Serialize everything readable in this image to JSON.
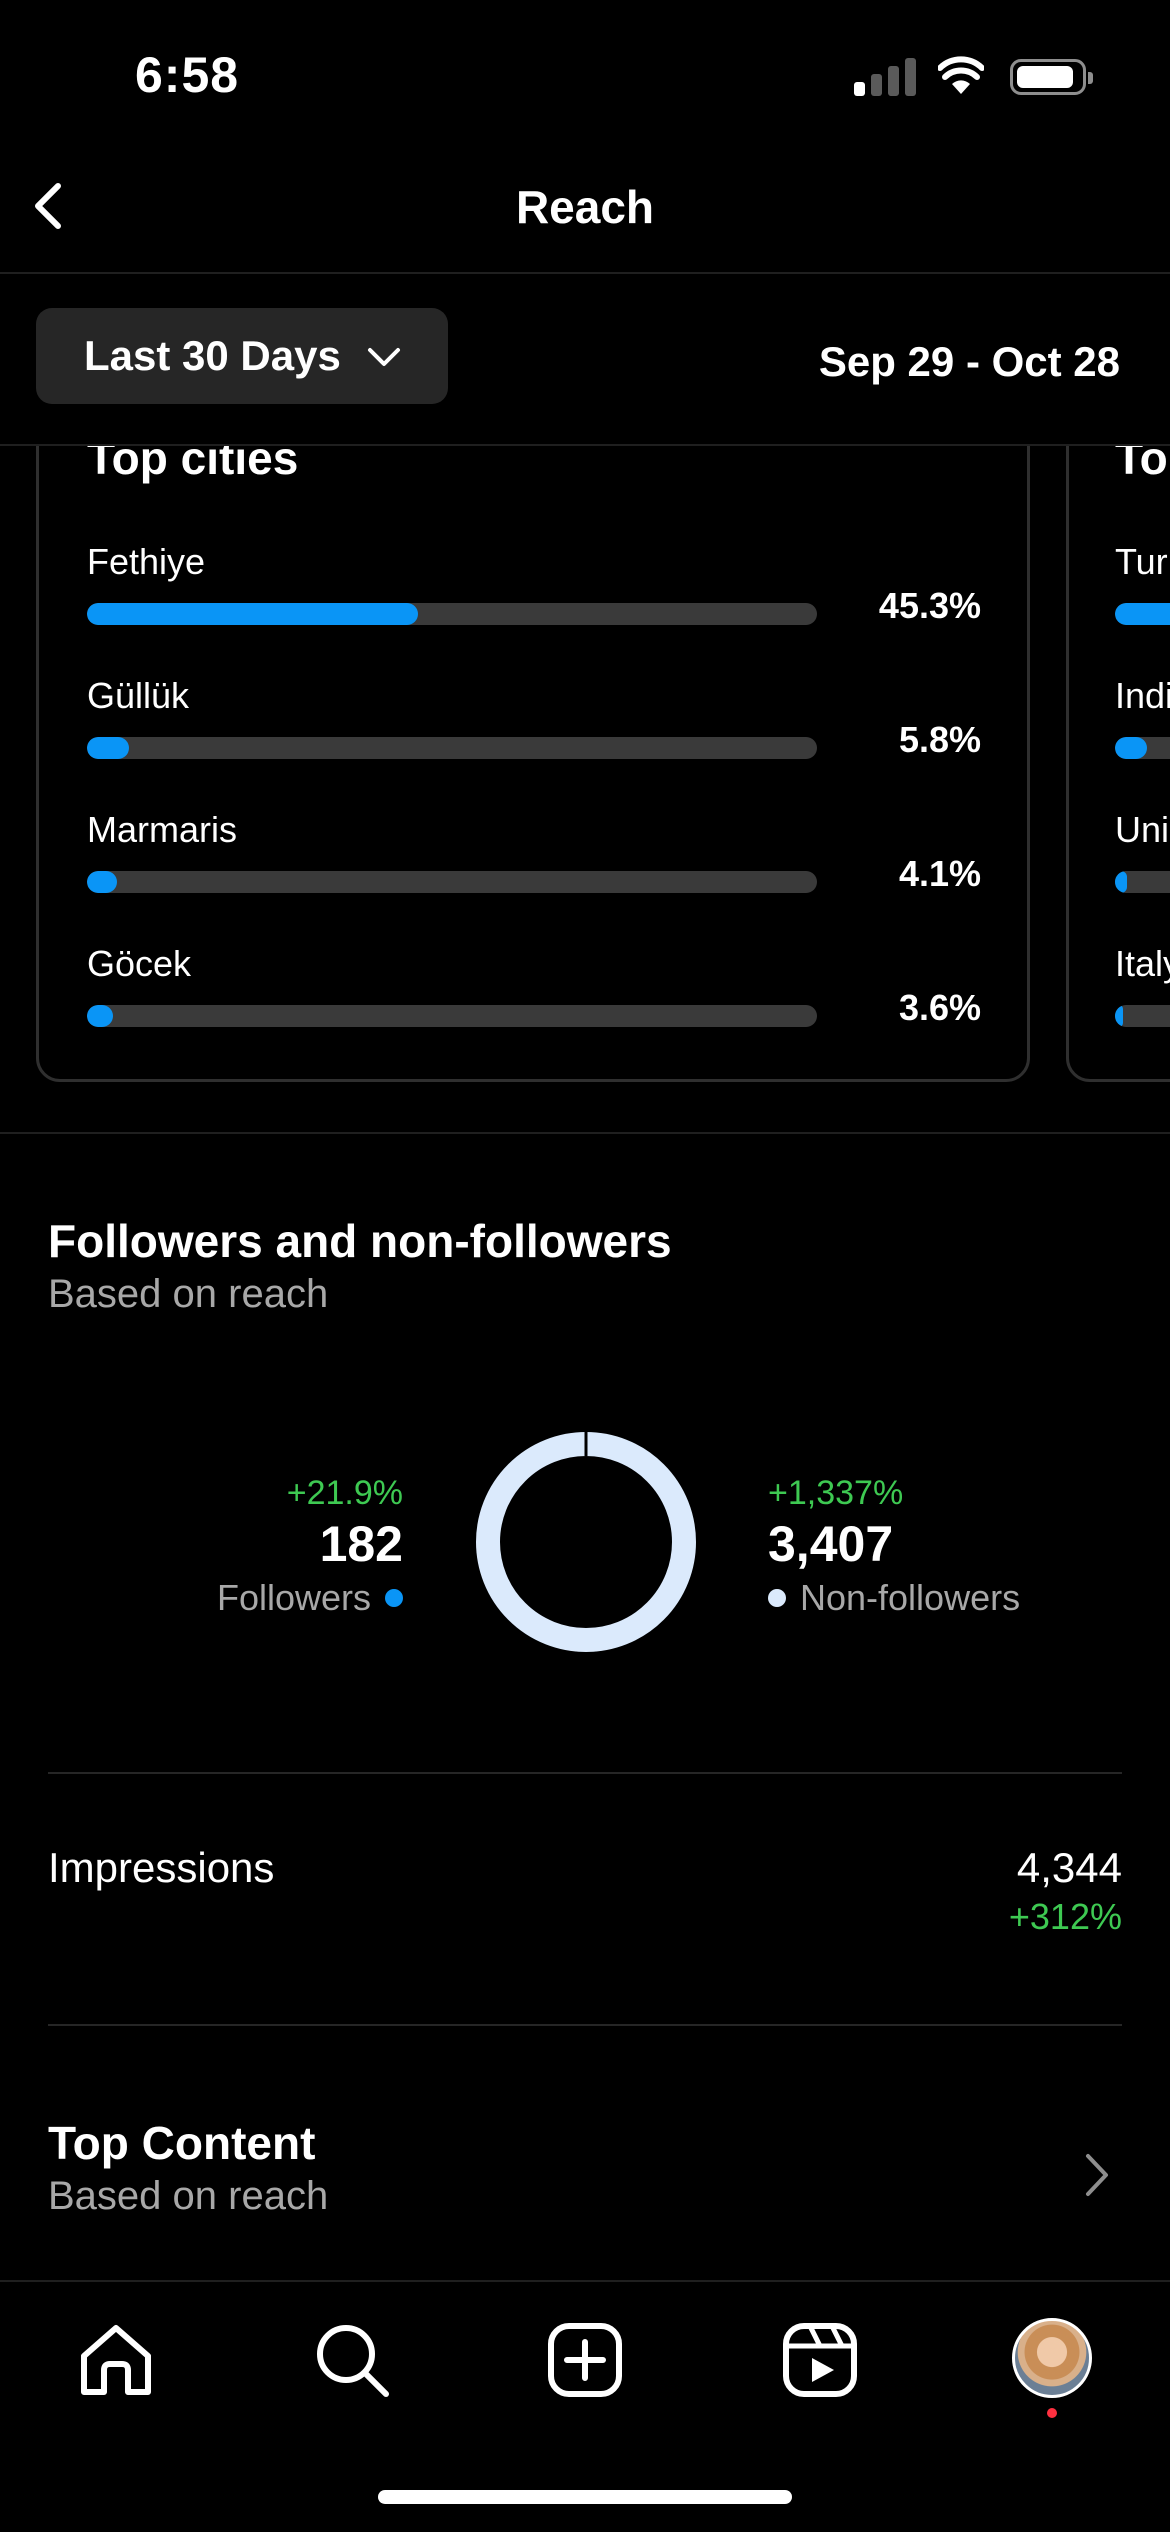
{
  "status_bar": {
    "time": "6:58"
  },
  "header": {
    "title": "Reach"
  },
  "filter": {
    "range_label": "Last 30 Days",
    "date_range": "Sep 29 - Oct 28"
  },
  "top_cities": {
    "title": "Top cities",
    "rows": [
      {
        "label": "Fethiye",
        "pct": "45.3%",
        "fraction": 0.453
      },
      {
        "label": "Güllük",
        "pct": "5.8%",
        "fraction": 0.058
      },
      {
        "label": "Marmaris",
        "pct": "4.1%",
        "fraction": 0.041
      },
      {
        "label": "Göcek",
        "pct": "3.6%",
        "fraction": 0.036
      }
    ]
  },
  "top_countries": {
    "title": "To",
    "rows": [
      {
        "label": "Tur",
        "fraction": 0.9
      },
      {
        "label": "Indi",
        "fraction": 0.08
      },
      {
        "label": "Uni",
        "fraction": 0.03
      },
      {
        "label": "Italy",
        "fraction": 0.01
      }
    ]
  },
  "followers_section": {
    "title": "Followers and non-followers",
    "subtitle": "Based on reach",
    "followers": {
      "change": "+21.9%",
      "value": "182",
      "label": "Followers",
      "color": "#0a95f6"
    },
    "non_followers": {
      "change": "+1,337%",
      "value": "3,407",
      "label": "Non-followers",
      "color": "#dbeafc"
    },
    "donut_fraction_followers": 0.051
  },
  "impressions": {
    "label": "Impressions",
    "value": "4,344",
    "change": "+312%"
  },
  "top_content": {
    "title": "Top Content",
    "subtitle": "Based on reach"
  },
  "nav": {
    "items": [
      "home-icon",
      "search-icon",
      "create-icon",
      "reels-icon",
      "profile-avatar"
    ]
  },
  "colors": {
    "accent": "#0a95f6",
    "positive": "#3ec952",
    "notification": "#ff3040"
  }
}
